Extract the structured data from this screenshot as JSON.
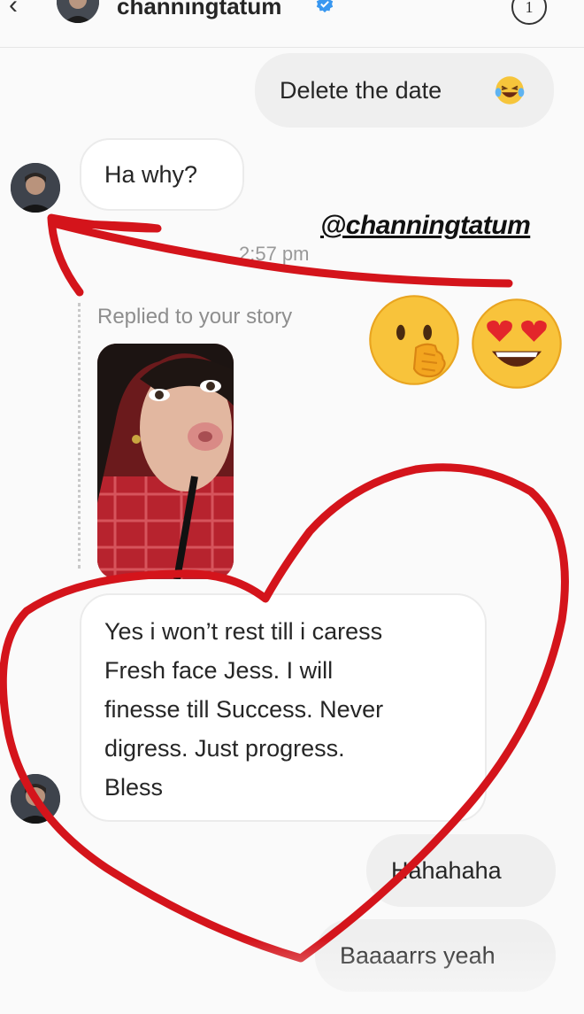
{
  "header": {
    "username": "channingtatum",
    "info_badge": "1"
  },
  "messages": {
    "m1": "Delete the date",
    "m2": "Ha why?",
    "timestamp": "2:57 pm",
    "replied_label": "Replied to your story",
    "m3_lines": [
      "Yes i won’t rest till i caress",
      "Fresh face Jess. I will",
      "finesse till Success. Never",
      "digress. Just progress.",
      "Bless"
    ],
    "m4": "Hahahaha",
    "m5": "Baaaarrs yeah"
  },
  "overlay": {
    "mention": "@channingtatum",
    "stickers": [
      "face-with-hand-over-mouth-emoji",
      "heart-eyes-emoji"
    ],
    "annotation_color": "#d4141b"
  },
  "icons": [
    "back-chevron-icon",
    "verified-badge-icon",
    "info-icon",
    "laughing-emoji-icon"
  ]
}
